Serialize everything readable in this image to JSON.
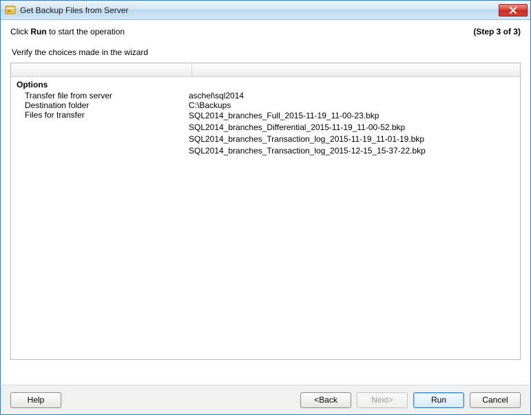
{
  "window": {
    "title": "Get Backup Files from Server"
  },
  "header": {
    "instruction_prefix": "Click ",
    "instruction_bold": "Run",
    "instruction_suffix": " to start the operation",
    "step": "(Step 3 of 3)"
  },
  "verify_label": "Verify the choices made in the wizard",
  "options": {
    "section_title": "Options",
    "rows": {
      "transfer_label": "Transfer file from server",
      "transfer_value": "aschel\\sql2014",
      "dest_label": "Destination folder",
      "dest_value": "C:\\Backups",
      "files_label": "Files for transfer"
    },
    "files": [
      "SQL2014_branches_Full_2015-11-19_11-00-23.bkp",
      "SQL2014_branches_Differential_2015-11-19_11-00-52.bkp",
      "SQL2014_branches_Transaction_log_2015-11-19_11-01-19.bkp",
      "SQL2014_branches_Transaction_log_2015-12-15_15-37-22.bkp"
    ]
  },
  "buttons": {
    "help": "Help",
    "back": "<Back",
    "next": "Next>",
    "run": "Run",
    "cancel": "Cancel"
  }
}
